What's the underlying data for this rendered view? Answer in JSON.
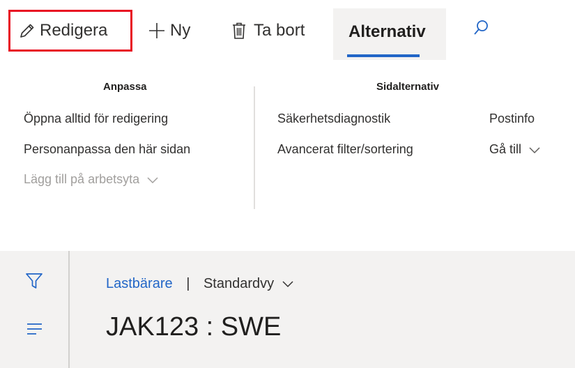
{
  "actionbar": {
    "edit_label": "Redigera",
    "new_label": "Ny",
    "delete_label": "Ta bort",
    "options_tab_label": "Alternativ"
  },
  "groups": {
    "customize": {
      "title": "Anpassa",
      "items": [
        "Öppna alltid för redigering",
        "Personanpassa den här sidan",
        "Lägg till på arbetsyta"
      ]
    },
    "page_options": {
      "title": "Sidalternativ",
      "items": [
        "Säkerhetsdiagnostik",
        "Avancerat filter/sortering",
        "Postinfo",
        "Gå till"
      ]
    }
  },
  "record": {
    "breadcrumb_link": "Lastbärare",
    "breadcrumb_separator": "|",
    "view_name": "Standardvy",
    "title": "JAK123 : SWE"
  },
  "icons": {
    "edit": "pencil-icon",
    "new": "plus-icon",
    "delete": "trash-icon",
    "search": "search-icon",
    "filter": "filter-icon",
    "menu": "hamburger-icon",
    "chevron": "chevron-down-icon"
  },
  "colors": {
    "accent": "#2266c7",
    "highlight_border": "#e81123",
    "disabled_text": "#a19f9d"
  }
}
